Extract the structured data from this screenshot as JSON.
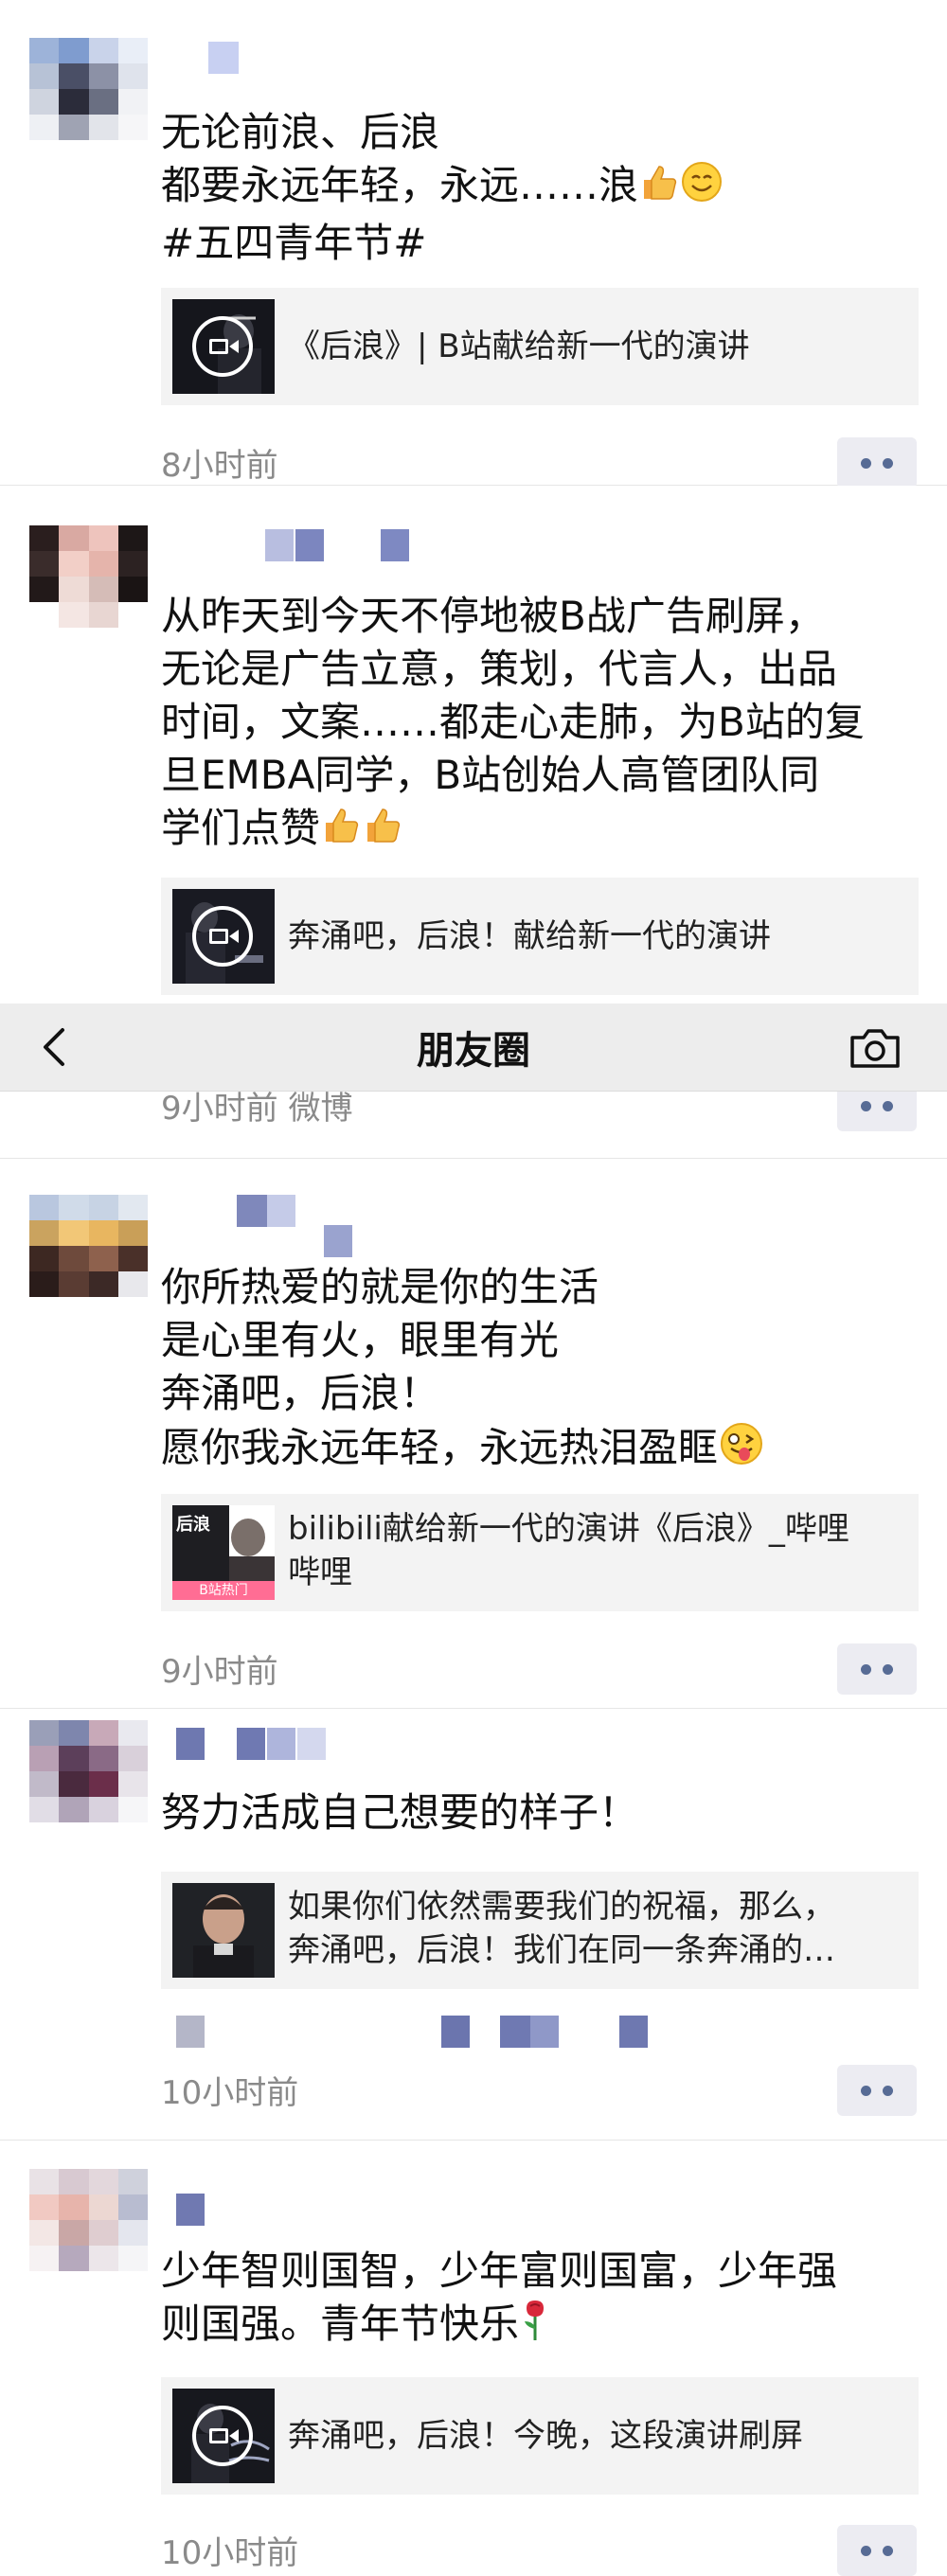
{
  "navbar": {
    "title": "朋友圈"
  },
  "posts": [
    {
      "text_lines": [
        "无论前浪、后浪",
        "都要永远年轻，永远……浪",
        "#五四青年节#"
      ],
      "link_title": "《后浪》| B站献给新一代的演讲",
      "time": "8小时前"
    },
    {
      "text_lines": [
        "从昨天到今天不停地被B战广告刷屏，",
        "无论是广告立意，策划，代言人，出品",
        "时间，文案……都走心走肺，为B站的复",
        "旦EMBA同学，B站创始人高管团队同",
        "学们点赞"
      ],
      "link_title": "奔涌吧，后浪！献给新一代的演讲",
      "time": "9小时前  微博"
    },
    {
      "text_lines": [
        "你所热爱的就是你的生活",
        "是心里有火，眼里有光",
        "奔涌吧，后浪！",
        "愿你我永远年轻，永远热泪盈眶"
      ],
      "link_title_lines": [
        "bilibili献给新一代的演讲《后浪》_哔哩",
        "哔哩"
      ],
      "thumb_badge": "B站热门",
      "thumb_caption": "后浪",
      "time": "9小时前"
    },
    {
      "text_lines": [
        "努力活成自己想要的样子！"
      ],
      "link_title_lines": [
        "如果你们依然需要我们的祝福，那么，",
        "奔涌吧，后浪！我们在同一条奔涌的…"
      ],
      "time": "10小时前"
    },
    {
      "text_lines": [
        "少年智则国智，少年富则国富，少年强",
        "则国强。青年节快乐"
      ],
      "link_title": "奔涌吧，后浪！今晚，这段演讲刷屏",
      "time": "10小时前"
    }
  ],
  "colors": {
    "link_blue": "#576b95",
    "time_gray": "#8a8a8a",
    "card_bg": "#f3f3f3",
    "navbar_bg": "#ededed"
  },
  "icons": [
    "back-arrow-icon",
    "camera-icon",
    "play-video-icon",
    "more-dots-icon",
    "thumbs-up-emoji",
    "smile-emoji",
    "tongue-out-emoji",
    "rose-emoji"
  ]
}
